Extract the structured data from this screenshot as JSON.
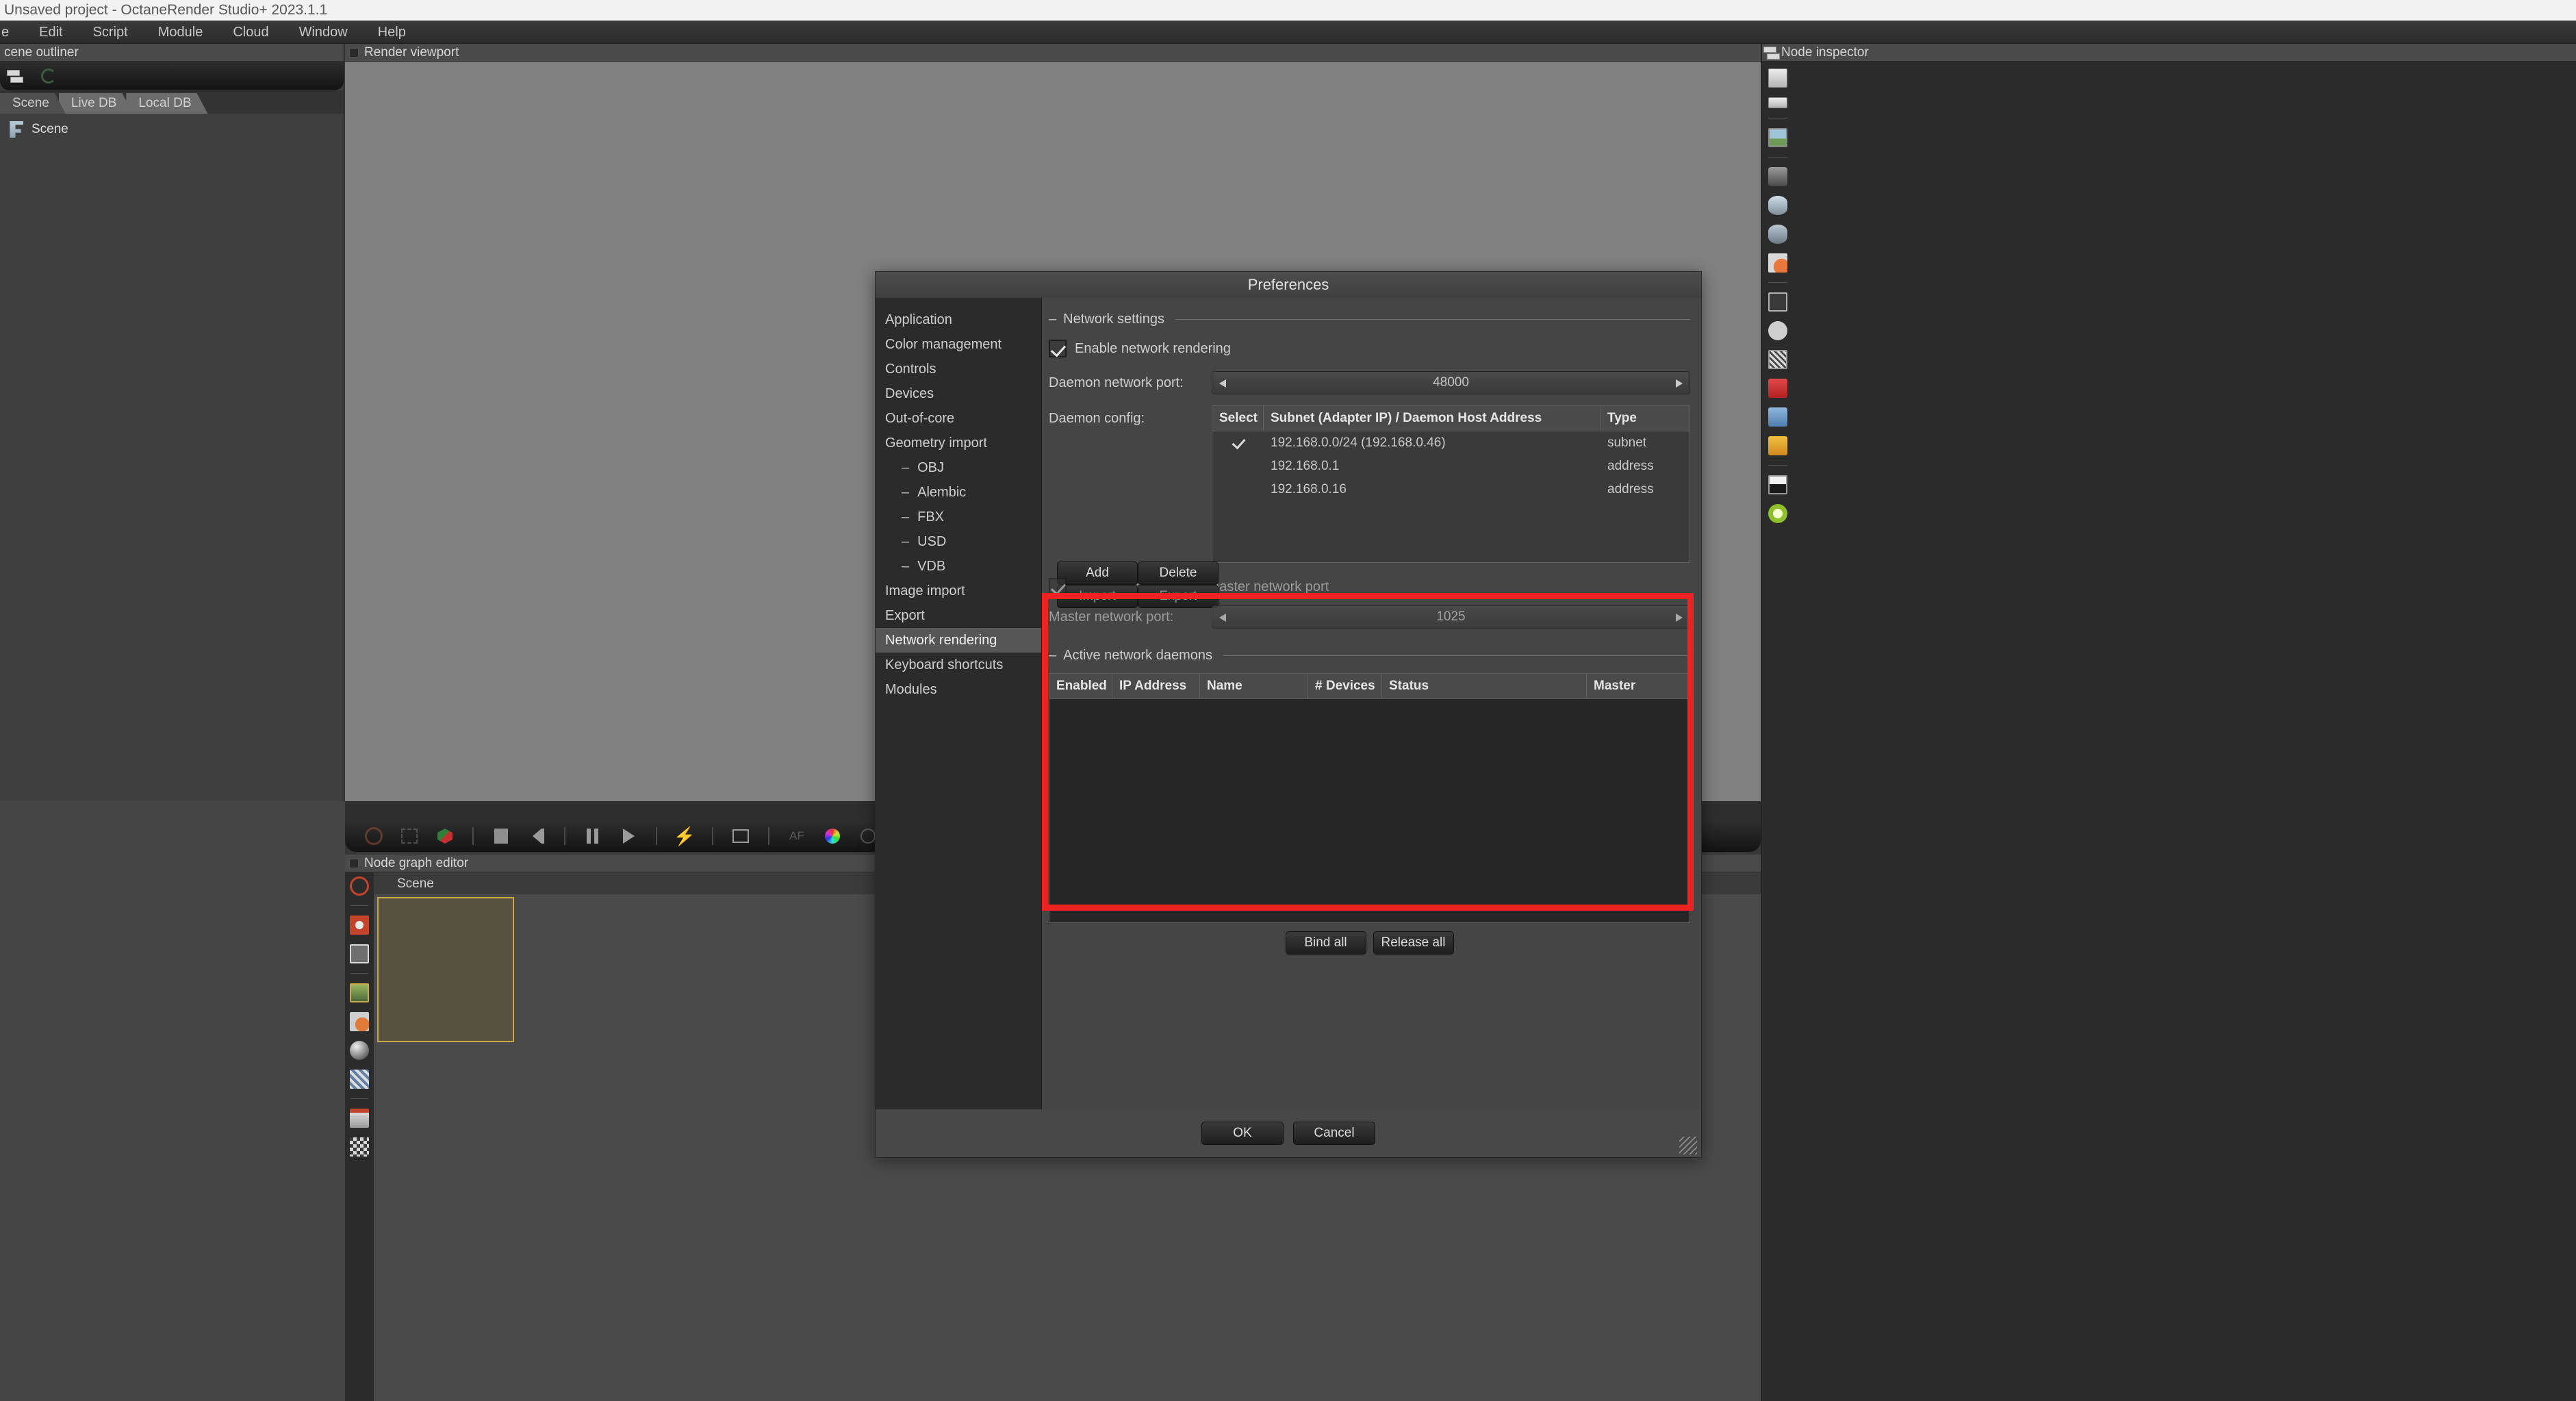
{
  "window": {
    "title": "Unsaved project - OctaneRender Studio+ 2023.1.1",
    "menu": [
      "e",
      "Edit",
      "Script",
      "Module",
      "Cloud",
      "Window",
      "Help"
    ]
  },
  "outliner": {
    "header": "cene outliner",
    "toolbar_icons": [
      "layers-icon",
      "refresh-icon"
    ],
    "tabs": [
      {
        "label": "Scene",
        "active": true
      },
      {
        "label": "Live DB",
        "active": false
      },
      {
        "label": "Local DB",
        "active": false
      }
    ],
    "tree": [
      {
        "label": "Scene",
        "icon": "scene-node-icon"
      }
    ]
  },
  "viewport": {
    "header": "Render viewport",
    "toolbar_icons": [
      "clear-selection-icon",
      "fit-icon",
      "cube-icon",
      "stop-icon",
      "rewind-icon",
      "pause-icon",
      "play-icon",
      "bolt-icon",
      "frame-icon",
      "af-icon",
      "color-wheel-icon",
      "clock-icon",
      "tone-icon",
      "denoise-icon",
      "region-icon",
      "crop-icon",
      "lasso-icon",
      "checker-icon"
    ]
  },
  "node_graph": {
    "header": "Node graph editor",
    "tabs": [
      {
        "label": "Scene",
        "active": true
      }
    ],
    "tool_icons": [
      "clear-selection-icon",
      "expand-nodes-icon",
      "collapse-nodes-icon",
      "render-target-icon",
      "material-icon",
      "sphere-preview-icon",
      "texture-preview-icon",
      "magnet-icon",
      "grid-snap-icon"
    ],
    "nodes": [
      {
        "name": "render-target-node"
      }
    ]
  },
  "inspector": {
    "header": "Node inspector",
    "icons": [
      "layers-icon",
      "stack-icon",
      "image-icon",
      "camera-icon",
      "environment-icon",
      "film-settings-icon",
      "material-ball-icon",
      "resolution-icon",
      "clock-icon",
      "kernel-icon",
      "red-cube-icon",
      "blue-layers-icon",
      "orange-box-icon",
      "mountain-icon",
      "sun-icon"
    ]
  },
  "preferences": {
    "title": "Preferences",
    "nav": [
      {
        "label": "Application",
        "sub": false,
        "selected": false
      },
      {
        "label": "Color management",
        "sub": false,
        "selected": false
      },
      {
        "label": "Controls",
        "sub": false,
        "selected": false
      },
      {
        "label": "Devices",
        "sub": false,
        "selected": false
      },
      {
        "label": "Out-of-core",
        "sub": false,
        "selected": false
      },
      {
        "label": "Geometry import",
        "sub": false,
        "selected": false
      },
      {
        "label": "OBJ",
        "sub": true,
        "selected": false
      },
      {
        "label": "Alembic",
        "sub": true,
        "selected": false
      },
      {
        "label": "FBX",
        "sub": true,
        "selected": false
      },
      {
        "label": "USD",
        "sub": true,
        "selected": false
      },
      {
        "label": "VDB",
        "sub": true,
        "selected": false
      },
      {
        "label": "Image import",
        "sub": false,
        "selected": false
      },
      {
        "label": "Export",
        "sub": false,
        "selected": false
      },
      {
        "label": "Network rendering",
        "sub": false,
        "selected": true
      },
      {
        "label": "Keyboard shortcuts",
        "sub": false,
        "selected": false
      },
      {
        "label": "Modules",
        "sub": false,
        "selected": false
      }
    ],
    "network_settings": {
      "group_title": "Network settings",
      "enable_network_rendering": {
        "label": "Enable network rendering",
        "checked": true
      },
      "daemon_network_port": {
        "label": "Daemon network port:",
        "value": "48000"
      },
      "daemon_config": {
        "label": "Daemon config:",
        "columns": [
          "Select",
          "Subnet (Adapter IP) / Daemon Host Address",
          "Type"
        ],
        "rows": [
          {
            "select": true,
            "address": "192.168.0.0/24 (192.168.0.46)",
            "type": "subnet"
          },
          {
            "select": false,
            "address": "192.168.0.1",
            "type": "address"
          },
          {
            "select": false,
            "address": "192.168.0.16",
            "type": "address"
          }
        ]
      },
      "buttons": {
        "add": "Add",
        "delete": "Delete",
        "import": "Import",
        "export": "Export"
      },
      "auto_master_port": {
        "label": "Automatically choose master network port",
        "checked": true
      },
      "master_network_port": {
        "label": "Master network port:",
        "value": "1025"
      }
    },
    "active_daemons": {
      "group_title": "Active network daemons",
      "columns": [
        "Enabled",
        "IP Address",
        "Name",
        "# Devices",
        "Status",
        "Master"
      ],
      "rows": [],
      "bind_all": "Bind all",
      "release_all": "Release all"
    },
    "footer": {
      "ok": "OK",
      "cancel": "Cancel"
    }
  },
  "annotation": {
    "highlight_color": "#ef2222"
  }
}
